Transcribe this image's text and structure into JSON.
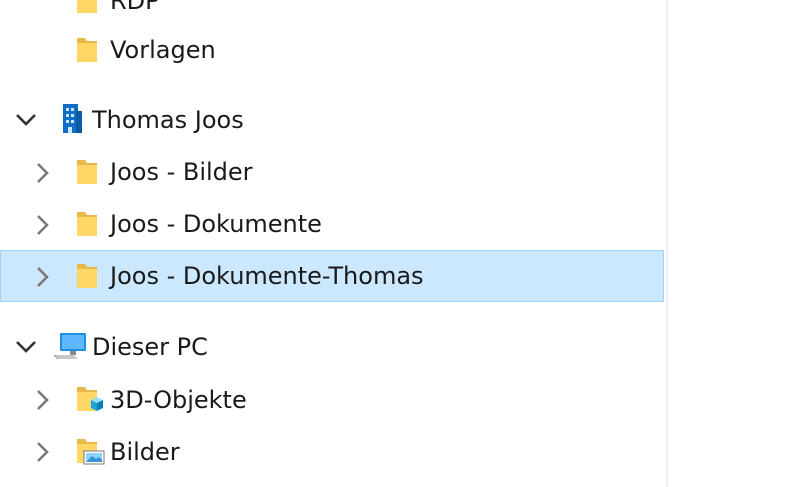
{
  "tree": {
    "items": [
      {
        "label": "RDP",
        "icon": "folder-icon",
        "expander": "none"
      },
      {
        "label": "Vorlagen",
        "icon": "folder-icon",
        "expander": "none"
      },
      {
        "label": "Thomas Joos",
        "icon": "building-icon",
        "expander": "expanded"
      },
      {
        "label": "Joos - Bilder",
        "icon": "folder-icon",
        "expander": "collapsed"
      },
      {
        "label": "Joos - Dokumente",
        "icon": "folder-icon",
        "expander": "collapsed"
      },
      {
        "label": "Joos - Dokumente-Thomas",
        "icon": "folder-icon",
        "expander": "collapsed",
        "selected": true
      },
      {
        "label": "Dieser PC",
        "icon": "computer-icon",
        "expander": "expanded"
      },
      {
        "label": "3D-Objekte",
        "icon": "3d-objects-folder-icon",
        "expander": "collapsed"
      },
      {
        "label": "Bilder",
        "icon": "pictures-folder-icon",
        "expander": "collapsed"
      }
    ]
  },
  "colors": {
    "selection_background": "#cce8ff",
    "selection_border": "#99d1ff",
    "folder_yellow": "#ffd766",
    "accent_blue": "#0078d7"
  }
}
